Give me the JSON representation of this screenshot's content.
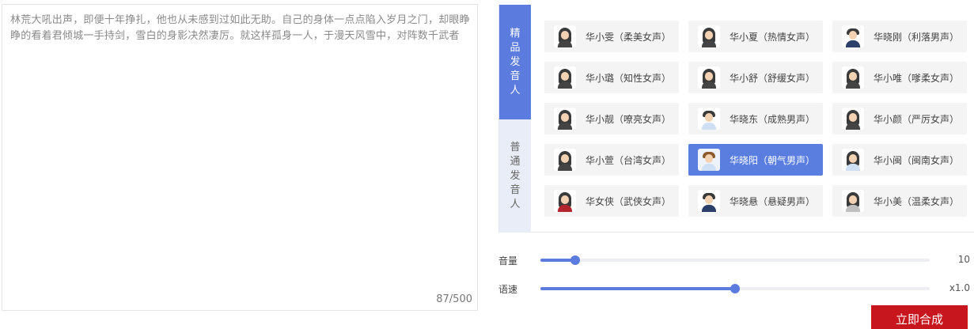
{
  "editor": {
    "text": "林荒大吼出声，即便十年挣扎，他也从未感到过如此无助。自己的身体一点点陷入岁月之门，却眼睁睁的看着君倾城一手持剑，雪白的身影决然凄厉。就这样孤身一人，于漫天风雪中，对阵数千武者",
    "char_count": "87/500"
  },
  "tabs": {
    "premium": "精品发音人",
    "normal": "普通发音人"
  },
  "voices": [
    {
      "label": "华小雯（柔美女声）",
      "icon": "female-avatar-icon"
    },
    {
      "label": "华小夏（热情女声）",
      "icon": "female-avatar-icon"
    },
    {
      "label": "华晓刚（利落男声）",
      "icon": "male-avatar-icon"
    },
    {
      "label": "华小璐（知性女声）",
      "icon": "female-avatar-icon"
    },
    {
      "label": "华小舒（舒缓女声）",
      "icon": "female-avatar-icon"
    },
    {
      "label": "华小唯（嗲柔女声）",
      "icon": "female-avatar-icon"
    },
    {
      "label": "华小靓（嘹亮女声）",
      "icon": "female-avatar-icon"
    },
    {
      "label": "华晓东（成熟男声）",
      "icon": "male-avatar-icon"
    },
    {
      "label": "华小颜（严厉女声）",
      "icon": "female-avatar-icon"
    },
    {
      "label": "华小萱（台湾女声）",
      "icon": "female-avatar-icon"
    },
    {
      "label": "华晓阳（朝气男声）",
      "icon": "male-avatar-icon",
      "selected": true
    },
    {
      "label": "华小闽（闽南女声）",
      "icon": "female-avatar-icon"
    },
    {
      "label": "华女侠（武侠女声）",
      "icon": "female-avatar-icon"
    },
    {
      "label": "华晓悬（悬疑男声）",
      "icon": "male-avatar-icon"
    },
    {
      "label": "华小美（温柔女声）",
      "icon": "female-avatar-icon"
    }
  ],
  "volume": {
    "label": "音量",
    "value": "10",
    "fraction": 0.09
  },
  "speed": {
    "label": "语速",
    "value": "x1.0",
    "fraction": 0.5
  },
  "actions": {
    "synthesize_label": "立即合成"
  },
  "colors": {
    "accent": "#5b7bde",
    "primary_button": "#c8161e"
  }
}
